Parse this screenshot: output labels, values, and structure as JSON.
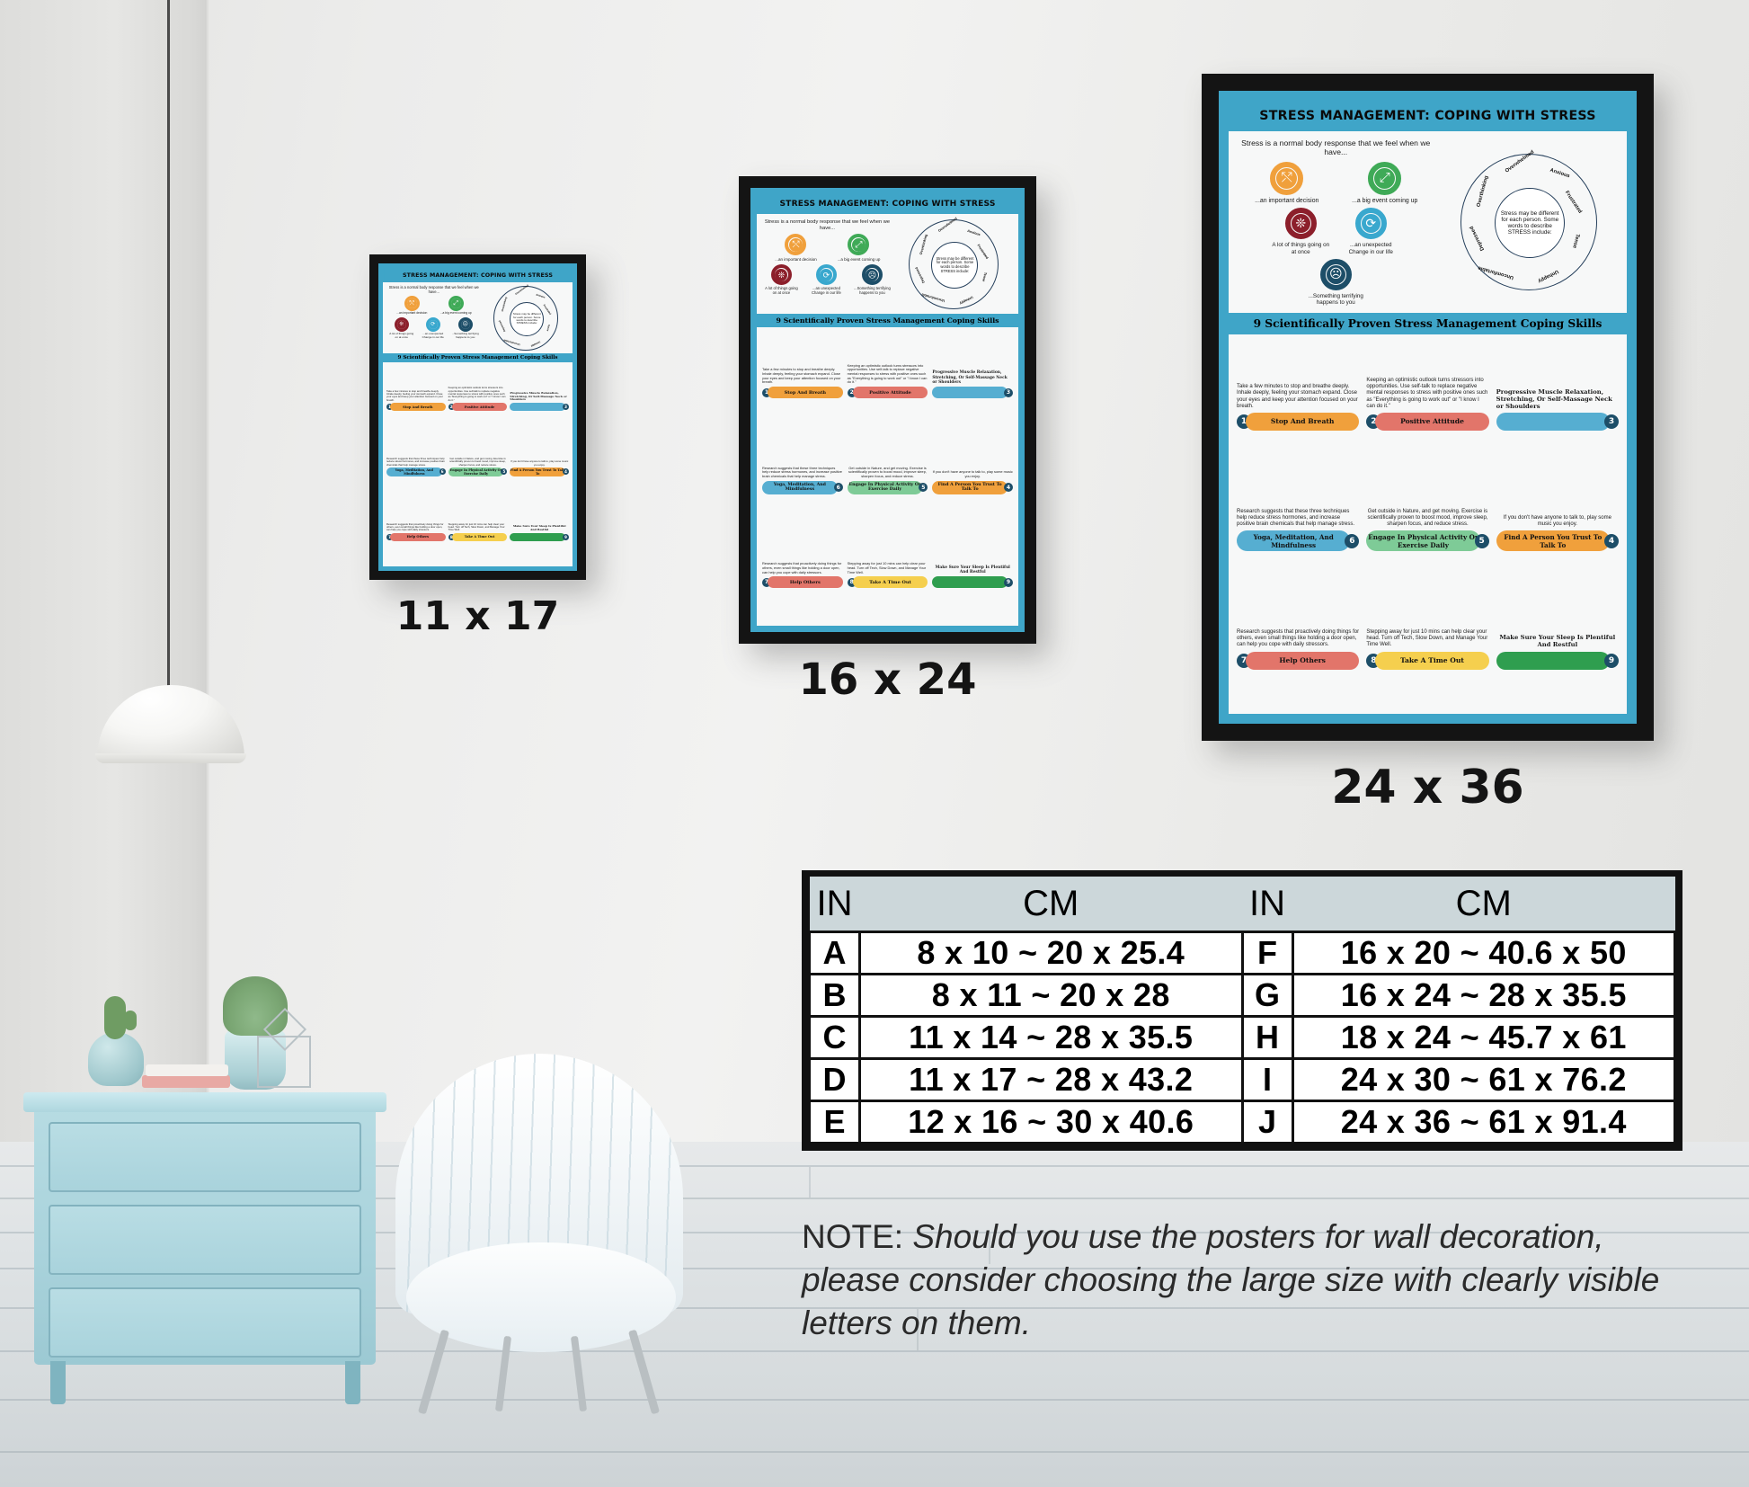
{
  "scene": {
    "room_description": "Living room wall mockup showing three framed stress-management posters in different sizes above a size-comparison chart"
  },
  "poster": {
    "title": "STRESS MANAGEMENT: COPING WITH STRESS",
    "intro": "Stress is a normal body response that we feel when we have...",
    "triggers": [
      {
        "label": "...an important decision",
        "color": "#f0a03c",
        "icon": "branching-arrows-icon"
      },
      {
        "label": "...a big event coming up",
        "color": "#3faa57",
        "icon": "expand-arrows-icon"
      },
      {
        "label": "A lot of things going on at once",
        "color": "#8c1f2b",
        "icon": "tangled-thoughts-icon"
      },
      {
        "label": "...an unexpected Change in our life",
        "color": "#39a8ce",
        "icon": "refresh-arrows-icon"
      },
      {
        "label": "...Something terrifying happens to you",
        "color": "#1d4e68",
        "icon": "scared-face-icon"
      }
    ],
    "wheel": {
      "center_text": "Stress may be different for each person. Some words to describe STRESS include:",
      "center_bold": "STRESS",
      "labels": [
        {
          "text": "Overwhelmed",
          "color": "#3fa84a"
        },
        {
          "text": "Anxious",
          "color": "#f0a03c"
        },
        {
          "text": "Frustrated",
          "color": "#e02b20"
        },
        {
          "text": "Tense",
          "color": "#e02b20"
        },
        {
          "text": "Unhappy",
          "color": "#1a2f6b"
        },
        {
          "text": "Uncomfortable",
          "color": "#1a2f6b"
        },
        {
          "text": "Depressed",
          "color": "#1c4f8a"
        },
        {
          "text": "Overthinking",
          "color": "#3fa84a"
        }
      ]
    },
    "section_title": "9 Scientifically Proven Stress Management Coping Skills",
    "skills": [
      {
        "num": "1",
        "name": "Stop And Breath",
        "desc": "Take a few minutes to stop and breathe deeply. Inhale deeply, feeling your stomach expand. Close your eyes and keep your attention focused on your breath.",
        "color": "#f0a03c",
        "dot": "#f0a03c"
      },
      {
        "num": "2",
        "name": "Positive Attitude",
        "desc": "Keeping an optimistic outlook turns stressors into opportunities. Use self-talk to replace negative mental responses to stress with positive ones such as \"Everything is going to work out\" or \"I know I can do it.\"",
        "color": "#e2756a",
        "dot": "#d93b2b"
      },
      {
        "num": "3",
        "name": "Progressive Muscle Relaxation, Stretching, Or Self-Massage Neck or Shoulders",
        "desc": "",
        "color": "#56aed1",
        "dot": "#1c5fa8"
      },
      {
        "num": "4",
        "name": "Find A Person You Trust To Talk To",
        "desc": "If you don't have anyone to talk to, play some music you enjoy.",
        "color": "#f0a03c",
        "dot": "#f0a03c"
      },
      {
        "num": "5",
        "name": "Engage In Physical Activity Or Exercise Daily",
        "desc": "Get outside in Nature, and get moving. Exercise is scientifically proven to boost mood, improve sleep, sharpen focus, and reduce stress.",
        "color": "#7ecb97",
        "dot": "#3fa84a"
      },
      {
        "num": "6",
        "name": "Yoga, Meditation, And Mindfulness",
        "desc": "Research suggests that these three techniques help reduce stress hormones, and increase positive brain chemicals that help manage stress.",
        "color": "#56aed1",
        "dot": "#1a2f6b"
      },
      {
        "num": "7",
        "name": "Help Others",
        "desc": "Research suggests that proactively doing things for others, even small things like holding a door open, can help you cope with daily stressors.",
        "color": "#e2756a",
        "dot": "#d93b2b"
      },
      {
        "num": "8",
        "name": "Take A Time Out",
        "desc": "Stepping away for just 10 mins can help clear your head. Turn off Tech, Slow Down, and Manage Your Time Well.",
        "color": "#f5cf4e",
        "dot": "#d93b2b"
      },
      {
        "num": "9",
        "name": "Make Sure Your Sleep Is Plentiful And Restful",
        "desc": "",
        "color": "#2f9e4f",
        "dot": "#3fa84a"
      }
    ]
  },
  "size_labels": {
    "small": "11 x 17",
    "medium": "16 x 24",
    "large": "24 x 36"
  },
  "size_table": {
    "headers": [
      "IN",
      "CM",
      "IN",
      "CM"
    ],
    "rows": [
      {
        "key_left": "A",
        "val_left": "8 x 10    ~  20 x 25.4",
        "key_right": "F",
        "val_right": "16 x 20 ~  40.6 x 50"
      },
      {
        "key_left": "B",
        "val_left": "8 x 11     ~  20 x 28",
        "key_right": "G",
        "val_right": "16 x 24 ~  28 x 35.5"
      },
      {
        "key_left": "C",
        "val_left": "11 x 14  ~  28 x 35.5",
        "key_right": "H",
        "val_right": "18 x 24 ~  45.7 x 61"
      },
      {
        "key_left": "D",
        "val_left": "11 x 17  ~  28 x 43.2",
        "key_right": "I",
        "val_right": "24 x 30 ~  61 x 76.2"
      },
      {
        "key_left": "E",
        "val_left": "12 x 16  ~  30 x 40.6",
        "key_right": "J",
        "val_right": "24 x 36 ~  61 x 91.4"
      }
    ]
  },
  "note": {
    "lead": "NOTE: ",
    "text": "Should you use the posters for wall decoration, please consider choosing the large size with clearly visible letters on them."
  },
  "colors": {
    "poster_blue": "#3fa5c8",
    "frame_black": "#141414",
    "table_header_bg": "#ccd7da",
    "wall": "#ececea"
  }
}
